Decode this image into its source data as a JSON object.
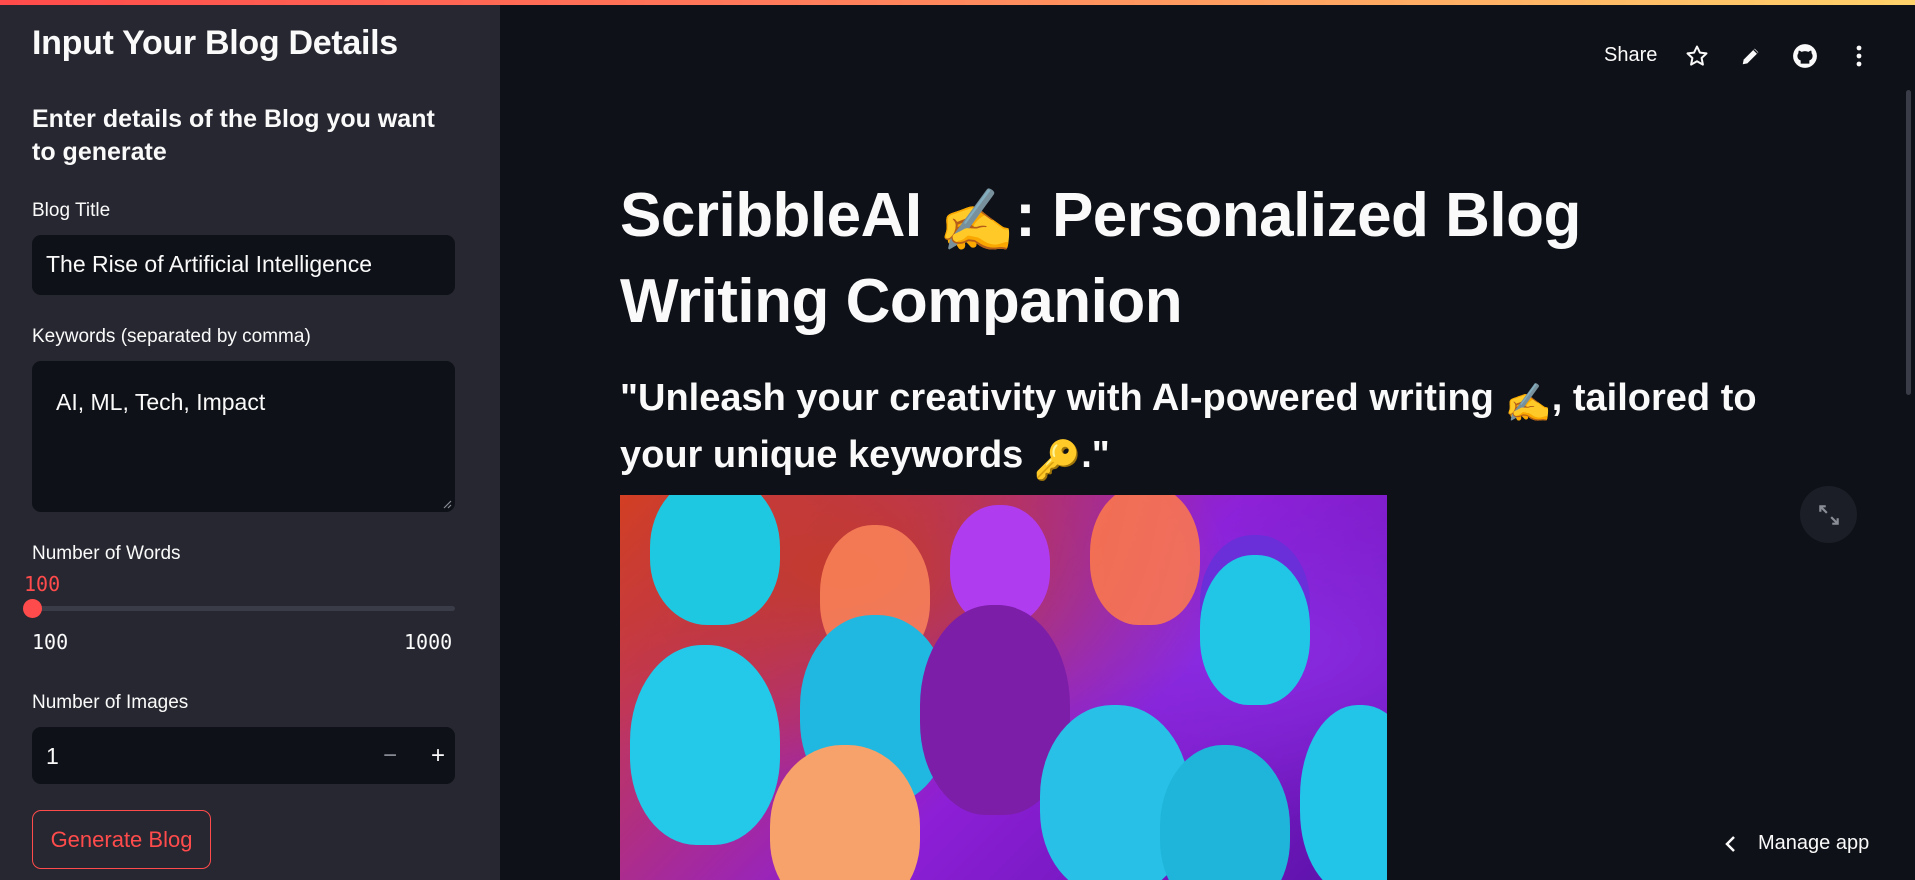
{
  "sidebar": {
    "title": "Input Your Blog Details",
    "subtitle": "Enter details of the Blog you want to generate",
    "blog_title": {
      "label": "Blog Title",
      "value": "The Rise of Artificial Intelligence"
    },
    "keywords": {
      "label": "Keywords (separated by comma)",
      "value": "AI, ML, Tech, Impact"
    },
    "words": {
      "label": "Number of Words",
      "value": "100",
      "min": "100",
      "max": "1000",
      "level": 0
    },
    "images": {
      "label": "Number of Images",
      "value": "1",
      "decrement": "−",
      "increment": "+"
    },
    "generate_label": "Generate Blog"
  },
  "toolbar": {
    "share_label": "Share",
    "icons": [
      "star-icon",
      "pencil-icon",
      "github-icon",
      "more-vertical-icon"
    ]
  },
  "main": {
    "title_part1": "ScribbleAI ",
    "title_emoji": "✍️",
    "title_part2": ": Personalized Blog Writing Companion",
    "subtitle_part1": "\"Unleash your creativity with AI-powered writing ",
    "subtitle_emoji1": "✍️",
    "subtitle_part2": ", tailored to your unique keywords ",
    "subtitle_emoji2": "🔑",
    "subtitle_part3": ".\""
  },
  "footer": {
    "manage_label": "Manage app"
  },
  "colors": {
    "accent": "#ff4b4b",
    "background": "#0e1117",
    "sidebar": "#262730"
  }
}
